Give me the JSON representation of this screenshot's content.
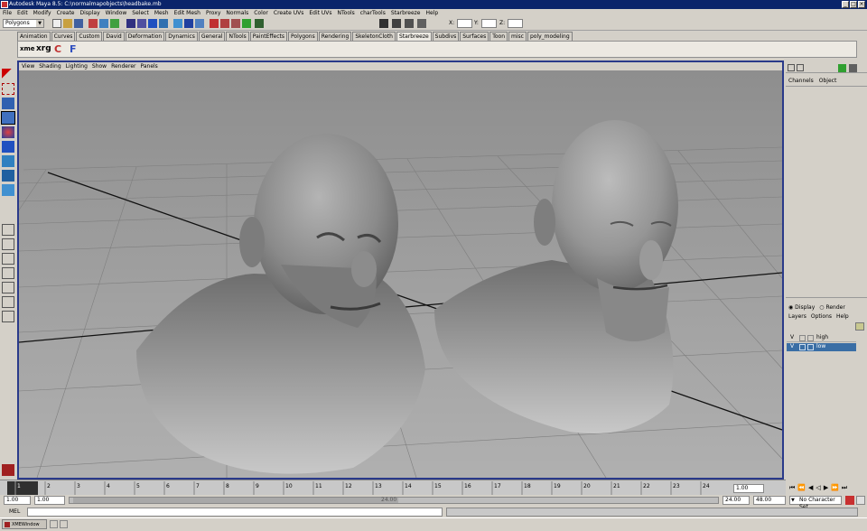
{
  "window": {
    "title": "Autodesk Maya 8.5: C:\\normalmapobjects\\headbake.mb",
    "buttons": [
      "_",
      "□",
      "×"
    ]
  },
  "menubar": {
    "items": [
      "File",
      "Edit",
      "Modify",
      "Create",
      "Display",
      "Window",
      "Select",
      "Mesh",
      "Edit Mesh",
      "Proxy",
      "Normals",
      "Color",
      "Create UVs",
      "Edit UVs",
      "NTools",
      "charTools",
      "Starbreeze",
      "Help"
    ]
  },
  "statusline": {
    "mode": "Polygons",
    "x_label": "X:",
    "y_label": "Y:",
    "z_label": "Z:"
  },
  "shelf": {
    "tabs": [
      "Animation",
      "Curves",
      "Custom",
      "David",
      "Deformation",
      "Dynamics",
      "General",
      "NTools",
      "PaintEffects",
      "Polygons",
      "Rendering",
      "SkeletonCloth",
      "Starbreeze",
      "Subdivs",
      "Surfaces",
      "Toon",
      "misc",
      "poly_modeling"
    ],
    "active_tab": "Starbreeze",
    "buttons": [
      "xme",
      "xrg",
      "C",
      "F"
    ]
  },
  "viewport": {
    "menu": [
      "View",
      "Shading",
      "Lighting",
      "Show",
      "Renderer",
      "Panels"
    ]
  },
  "channelbox": {
    "menu": [
      "Channels",
      "Object"
    ]
  },
  "layereditor": {
    "options": [
      "Display",
      "Render"
    ],
    "menu": [
      "Layers",
      "Options",
      "Help"
    ],
    "layers": [
      {
        "visible": "V",
        "name": "high",
        "selected": false
      },
      {
        "visible": "V",
        "name": "low",
        "selected": true
      }
    ]
  },
  "timeslider": {
    "ticks": [
      "1",
      "2",
      "3",
      "4",
      "5",
      "6",
      "7",
      "8",
      "9",
      "10",
      "11",
      "12",
      "13",
      "14",
      "15",
      "16",
      "17",
      "18",
      "19",
      "20",
      "21",
      "22",
      "23",
      "24"
    ],
    "current_frame": "1.00"
  },
  "rangeslider": {
    "start": "1.00",
    "inner_start": "1.00",
    "inner_end": "24.00",
    "end": "48.00",
    "range_label": "24.00",
    "character_set": "No Character Set"
  },
  "cmdline": {
    "label": "MEL"
  },
  "taskbar": {
    "item": "XMEWindow"
  }
}
